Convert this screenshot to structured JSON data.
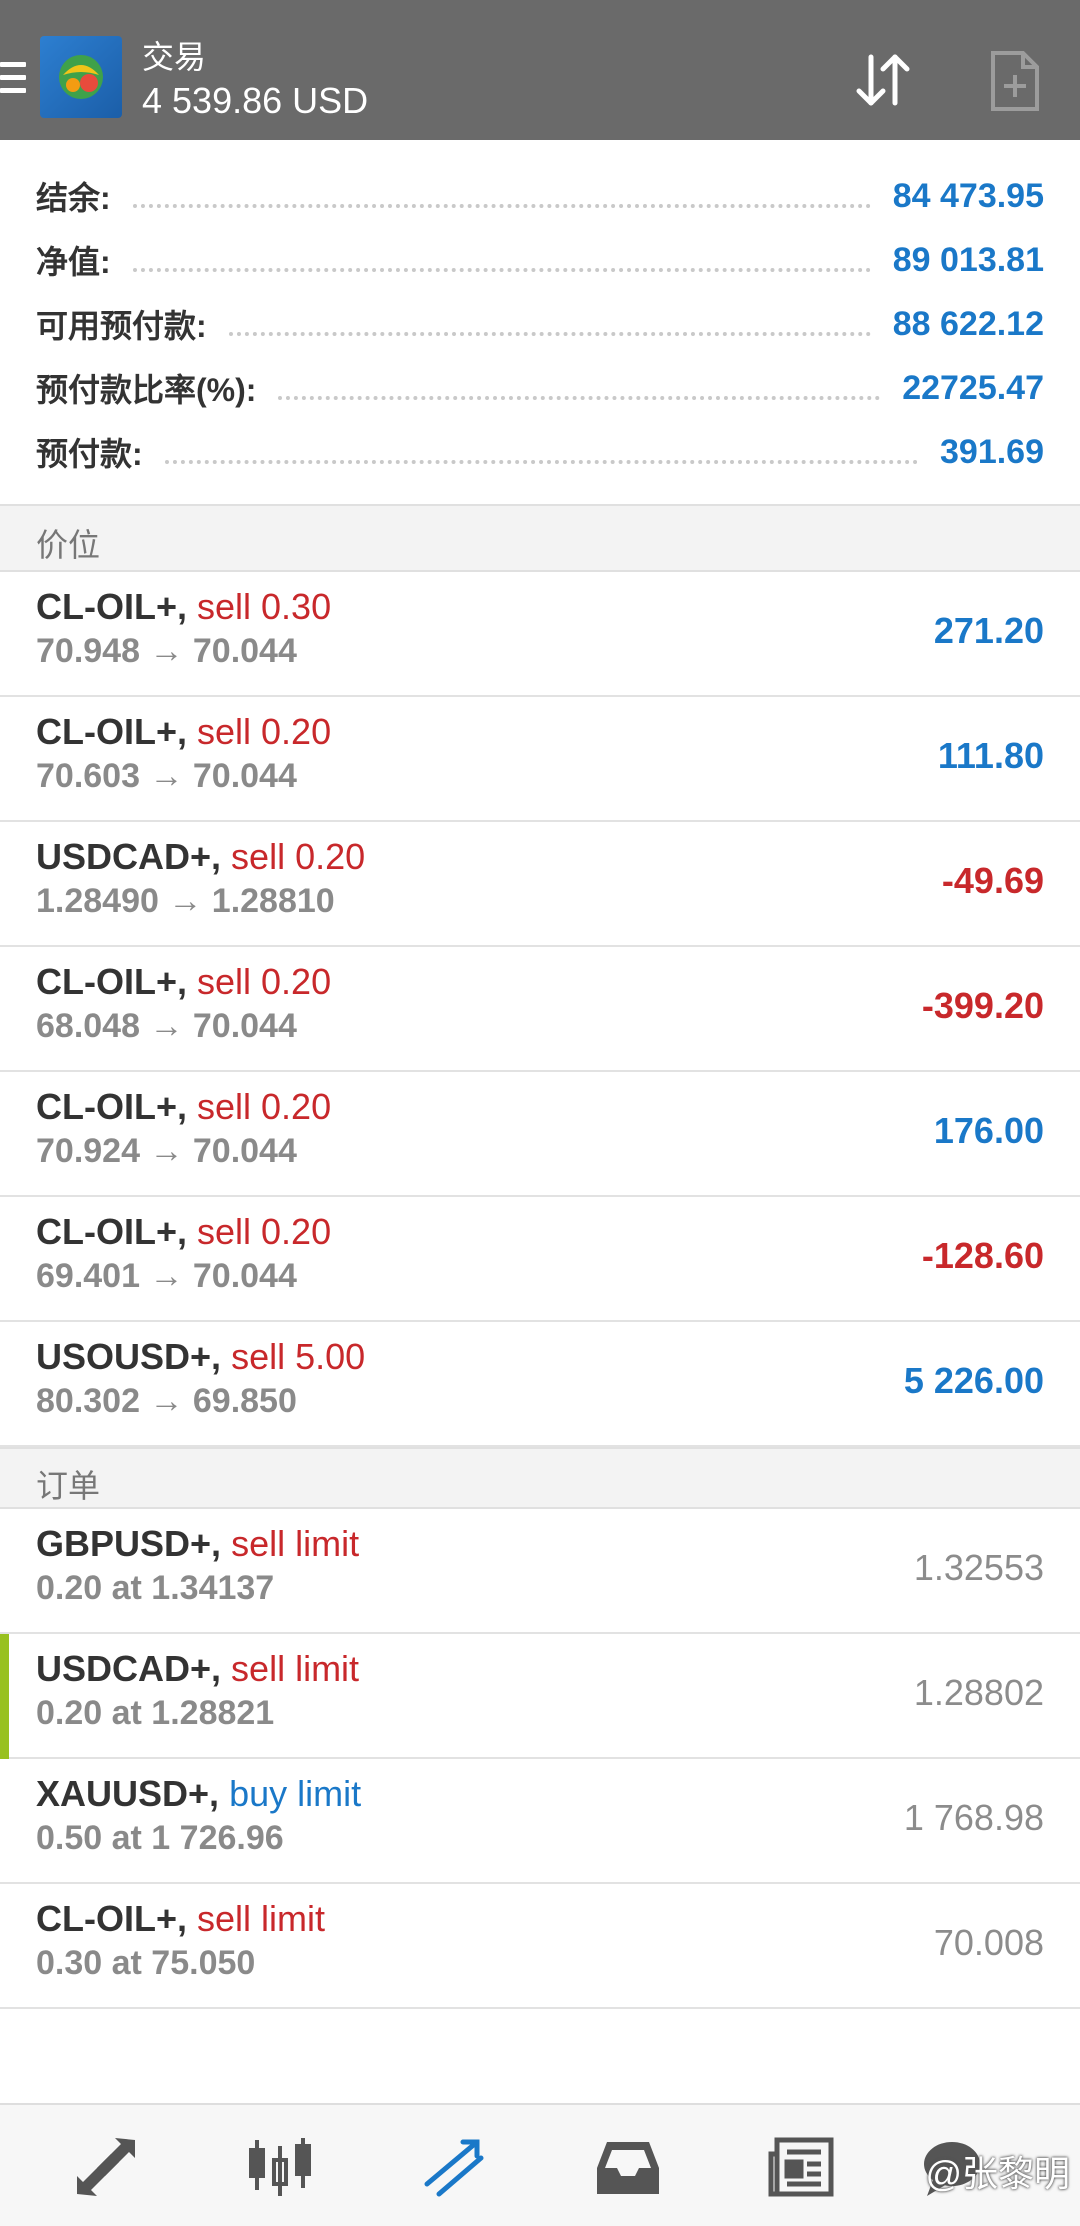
{
  "header": {
    "title": "交易",
    "balance": "4 539.86 USD"
  },
  "summary": [
    {
      "label": "结余:",
      "value": "84 473.95"
    },
    {
      "label": "净值:",
      "value": "89 013.81"
    },
    {
      "label": "可用预付款:",
      "value": "88 622.12"
    },
    {
      "label": "预付款比率(%):",
      "value": "22725.47"
    },
    {
      "label": "预付款:",
      "value": "391.69"
    }
  ],
  "positions_header": "价位",
  "positions": [
    {
      "symbol": "CL-OIL+,",
      "action": "sell 0.30",
      "prices": "70.948 → 70.044",
      "profit": "271.20",
      "sign": "pos"
    },
    {
      "symbol": "CL-OIL+,",
      "action": "sell 0.20",
      "prices": "70.603 → 70.044",
      "profit": "111.80",
      "sign": "pos"
    },
    {
      "symbol": "USDCAD+,",
      "action": "sell 0.20",
      "prices": "1.28490 → 1.28810",
      "profit": "-49.69",
      "sign": "neg"
    },
    {
      "symbol": "CL-OIL+,",
      "action": "sell 0.20",
      "prices": "68.048 → 70.044",
      "profit": "-399.20",
      "sign": "neg"
    },
    {
      "symbol": "CL-OIL+,",
      "action": "sell 0.20",
      "prices": "70.924 → 70.044",
      "profit": "176.00",
      "sign": "pos"
    },
    {
      "symbol": "CL-OIL+,",
      "action": "sell 0.20",
      "prices": "69.401 → 70.044",
      "profit": "-128.60",
      "sign": "neg"
    },
    {
      "symbol": "USOUSD+,",
      "action": "sell 5.00",
      "prices": "80.302 → 69.850",
      "profit": "5 226.00",
      "sign": "pos"
    }
  ],
  "orders_header": "订单",
  "orders": [
    {
      "symbol": "GBPUSD+,",
      "action": "sell limit",
      "detail": "0.20 at 1.34137",
      "price": "1.32553"
    },
    {
      "symbol": "USDCAD+,",
      "action": "sell limit",
      "detail": "0.20 at 1.28821",
      "price": "1.28802"
    },
    {
      "symbol": "XAUUSD+,",
      "action": "buy limit",
      "detail": "0.50 at 1 726.96",
      "price": "1 768.98"
    },
    {
      "symbol": "CL-OIL+,",
      "action": "sell limit",
      "detail": "0.30 at 75.050",
      "price": "70.008"
    }
  ],
  "watermark": "@张黎明",
  "colors": {
    "header_bg": "#6a6a6a",
    "value_blue": "#1a78c8",
    "loss_red": "#c8282b",
    "selected_marker": "#98c11f"
  },
  "icons": {
    "menu": "hamburger-icon",
    "sort": "sort-arrows-icon",
    "new_order": "new-document-icon",
    "nav": [
      "quotes-icon",
      "chart-icon",
      "trade-icon",
      "history-icon",
      "news-icon",
      "chat-icon"
    ]
  }
}
